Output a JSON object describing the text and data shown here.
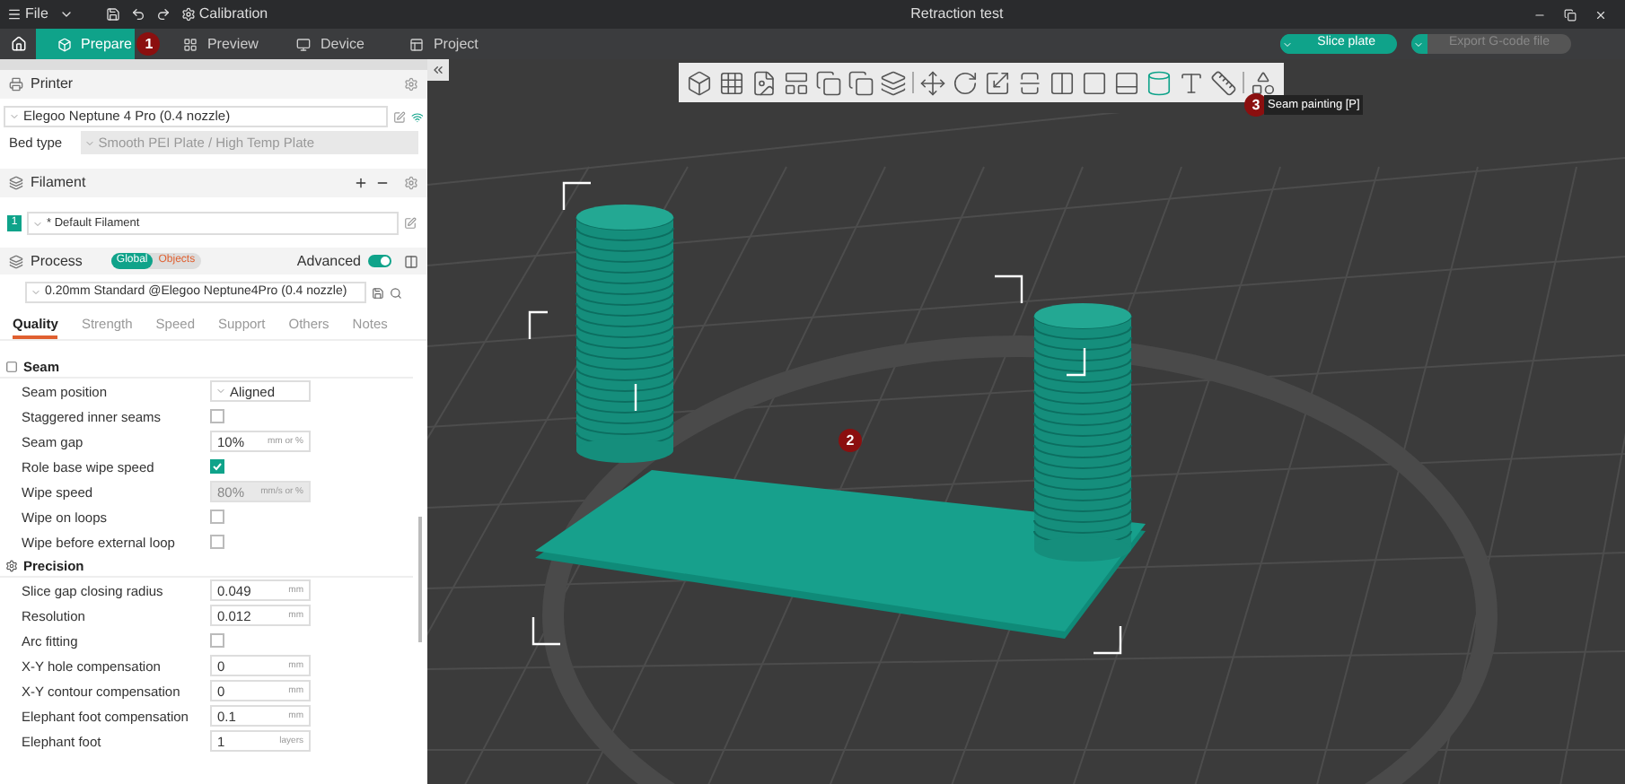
{
  "menu": {
    "file": "File",
    "calibration": "Calibration"
  },
  "window": {
    "title": "Retraction test"
  },
  "tabs": [
    {
      "label": "Prepare",
      "selected": true
    },
    {
      "label": "Preview",
      "selected": false
    },
    {
      "label": "Device",
      "selected": false
    },
    {
      "label": "Project",
      "selected": false
    }
  ],
  "actions": [
    {
      "label": "Slice plate",
      "disabled": false
    },
    {
      "label": "Export G-code file",
      "disabled": true
    }
  ],
  "printer": {
    "title": "Printer",
    "name": "Elegoo Neptune 4 Pro (0.4 nozzle)",
    "bed_type_label": "Bed type",
    "bed_type": "Smooth PEI Plate / High Temp Plate"
  },
  "filament": {
    "title": "Filament",
    "items": [
      {
        "index": "1",
        "name": "* Default Filament",
        "color": "#0fa38a"
      }
    ]
  },
  "process": {
    "title": "Process",
    "scope": [
      {
        "label": "Global",
        "selected": true
      },
      {
        "label": "Objects",
        "selected": false
      }
    ],
    "advanced_label": "Advanced",
    "advanced": true,
    "profile": "0.20mm Standard @Elegoo Neptune4Pro (0.4 nozzle)"
  },
  "setting_tabs": [
    {
      "label": "Quality",
      "selected": true
    },
    {
      "label": "Strength",
      "selected": false
    },
    {
      "label": "Speed",
      "selected": false
    },
    {
      "label": "Support",
      "selected": false
    },
    {
      "label": "Others",
      "selected": false
    },
    {
      "label": "Notes",
      "selected": false
    }
  ],
  "sections": [
    {
      "title": "Seam",
      "rows": [
        {
          "kind": "select",
          "label": "Seam position",
          "value": "Aligned"
        },
        {
          "kind": "checkbox",
          "label": "Staggered inner seams",
          "checked": false
        },
        {
          "kind": "input",
          "label": "Seam gap",
          "value": "10%",
          "unit": "mm or %",
          "disabled": false
        },
        {
          "kind": "checkbox",
          "label": "Role base wipe speed",
          "checked": true
        },
        {
          "kind": "input",
          "label": "Wipe speed",
          "value": "80%",
          "unit": "mm/s or %",
          "disabled": true
        },
        {
          "kind": "checkbox",
          "label": "Wipe on loops",
          "checked": false
        },
        {
          "kind": "checkbox",
          "label": "Wipe before external loop",
          "checked": false
        }
      ]
    },
    {
      "title": "Precision",
      "rows": [
        {
          "kind": "input",
          "label": "Slice gap closing radius",
          "value": "0.049",
          "unit": "mm",
          "disabled": false
        },
        {
          "kind": "input",
          "label": "Resolution",
          "value": "0.012",
          "unit": "mm",
          "disabled": false
        },
        {
          "kind": "checkbox",
          "label": "Arc fitting",
          "checked": false
        },
        {
          "kind": "input",
          "label": "X-Y hole compensation",
          "value": "0",
          "unit": "mm",
          "disabled": false
        },
        {
          "kind": "input",
          "label": "X-Y contour compensation",
          "value": "0",
          "unit": "mm",
          "disabled": false
        },
        {
          "kind": "input",
          "label": "Elephant foot compensation",
          "value": "0.1",
          "unit": "mm",
          "disabled": false
        },
        {
          "kind": "spin",
          "label": "Elephant foot",
          "value": "1",
          "unit": "layers"
        }
      ]
    }
  ],
  "tooltip": "Seam painting [P]",
  "markers": [
    {
      "label": "1"
    },
    {
      "label": "2"
    },
    {
      "label": "3"
    }
  ]
}
